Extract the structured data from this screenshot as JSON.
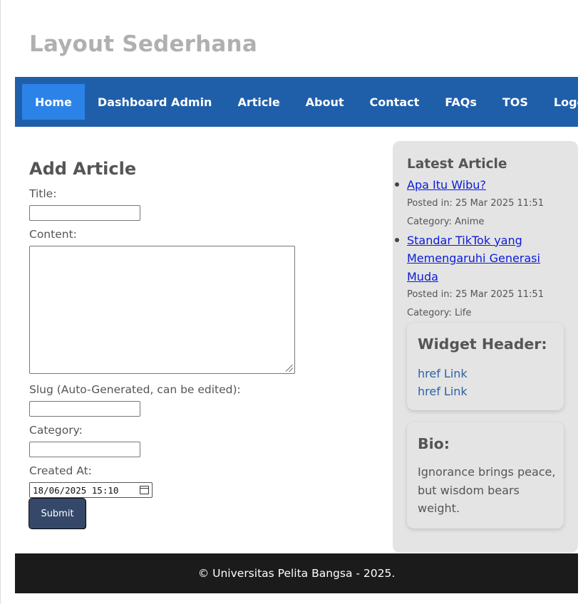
{
  "site": {
    "title": "Layout Sederhana"
  },
  "nav": {
    "items": [
      {
        "label": "Home",
        "active": true
      },
      {
        "label": "Dashboard Admin",
        "active": false
      },
      {
        "label": "Article",
        "active": false
      },
      {
        "label": "About",
        "active": false
      },
      {
        "label": "Contact",
        "active": false
      },
      {
        "label": "FAQs",
        "active": false
      },
      {
        "label": "TOS",
        "active": false
      },
      {
        "label": "Logout",
        "active": false
      }
    ]
  },
  "form": {
    "heading": "Add Article",
    "title_label": "Title:",
    "title_value": "",
    "content_label": "Content:",
    "content_value": "",
    "slug_label": "Slug (Auto-Generated, can be edited):",
    "slug_value": "",
    "category_label": "Category:",
    "category_value": "",
    "created_label": "Created At:",
    "created_value": "18/06/2025 15:10",
    "submit_label": "Submit"
  },
  "sidebar": {
    "latest_title": "Latest Article",
    "articles": [
      {
        "title": "Apa Itu Wibu?",
        "posted": "Posted in: 25 Mar 2025 11:51",
        "category": "Category: Anime"
      },
      {
        "title": "Standar TikTok yang Memengaruhi Generasi Muda",
        "posted": "Posted in: 25 Mar 2025 11:51",
        "category": "Category: Life"
      }
    ],
    "widget": {
      "title": "Widget Header:",
      "links": [
        "href Link",
        "href Link"
      ]
    },
    "bio": {
      "title": "Bio:",
      "text": "Ignorance brings peace, but wisdom bears weight."
    }
  },
  "footer": {
    "text": "© Universitas Pelita Bangsa - 2025."
  },
  "colors": {
    "nav_bg": "#1f5faa",
    "nav_active": "#2b83e8",
    "footer_bg": "#1b1b1b",
    "sidebar_bg": "#e4e4e4",
    "submit_bg": "#35486a"
  }
}
